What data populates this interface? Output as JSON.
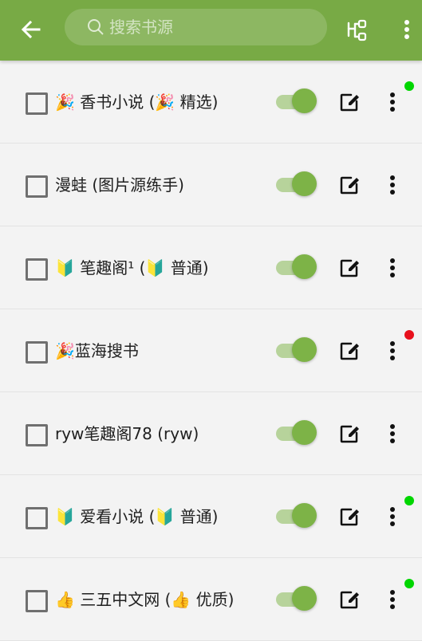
{
  "header": {
    "search_placeholder": "搜索书源",
    "icons": [
      "back-arrow-icon",
      "search-icon",
      "group-icon",
      "more-vertical-icon"
    ]
  },
  "sources": [
    {
      "name": "🎉 香书小说 (🎉 精选)",
      "enabled": true,
      "status": "success",
      "status_color": "#00d600"
    },
    {
      "name": "漫蛙 (图片源练手)",
      "enabled": true,
      "status": "none",
      "status_color": ""
    },
    {
      "name": "🔰 笔趣阁¹ (🔰 普通)",
      "enabled": true,
      "status": "none",
      "status_color": ""
    },
    {
      "name": "🎉蓝海搜书",
      "enabled": true,
      "status": "error",
      "status_color": "#e8101c"
    },
    {
      "name": "ryw笔趣阁78 (ryw)",
      "enabled": true,
      "status": "none",
      "status_color": ""
    },
    {
      "name": "🔰 爱看小说 (🔰 普通)",
      "enabled": true,
      "status": "success",
      "status_color": "#00d600"
    },
    {
      "name": "👍 三五中文网 (👍 优质)",
      "enabled": true,
      "status": "success",
      "status_color": "#00d600"
    }
  ],
  "colors": {
    "toolbar": "#78aa45",
    "switch_on": "#7db347",
    "success_dot": "#00d600",
    "error_dot": "#e8101c"
  }
}
